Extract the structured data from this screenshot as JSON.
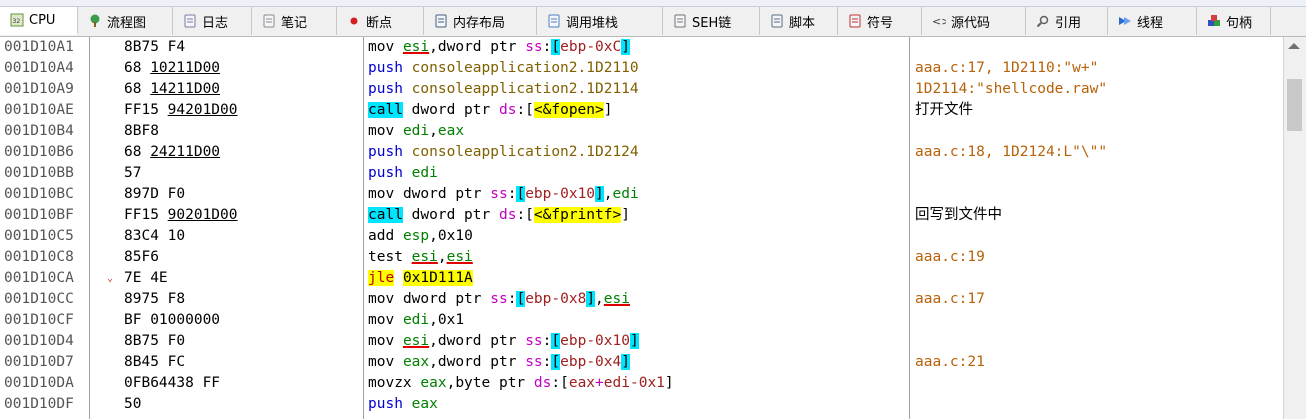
{
  "tabs": [
    {
      "label": "CPU",
      "icon": "cpu-icon",
      "active": true,
      "width": 78
    },
    {
      "label": "流程图",
      "icon": "flowchart-icon",
      "width": 95
    },
    {
      "label": "日志",
      "icon": "log-icon",
      "width": 79
    },
    {
      "label": "笔记",
      "icon": "notes-icon",
      "width": 85
    },
    {
      "label": "断点",
      "icon": "breakpoint-icon",
      "width": 87
    },
    {
      "label": "内存布局",
      "icon": "memory-map-icon",
      "width": 113
    },
    {
      "label": "调用堆栈",
      "icon": "call-stack-icon",
      "width": 126
    },
    {
      "label": "SEH链",
      "icon": "seh-chain-icon",
      "width": 97
    },
    {
      "label": "脚本",
      "icon": "script-icon",
      "width": 78
    },
    {
      "label": "符号",
      "icon": "symbols-icon",
      "width": 84
    },
    {
      "label": "源代码",
      "icon": "source-icon",
      "width": 104
    },
    {
      "label": "引用",
      "icon": "references-icon",
      "width": 82
    },
    {
      "label": "线程",
      "icon": "threads-icon",
      "width": 89
    },
    {
      "label": "句柄",
      "icon": "handles-icon",
      "width": 74
    }
  ],
  "rows": [
    {
      "addr": "001D10A1",
      "bytes": "8B75 F4",
      "ins": "mov",
      "ops": "esi,dword ptr ss:[ebp-0xC]",
      "comment": ""
    },
    {
      "addr": "001D10A4",
      "bytes": "68 10211D00",
      "ins": "push",
      "ops": "consoleapplication2.1D2110",
      "comment": "aaa.c:17, 1D2110:\"w+\""
    },
    {
      "addr": "001D10A9",
      "bytes": "68 14211D00",
      "ins": "push",
      "ops": "consoleapplication2.1D2114",
      "comment": "1D2114:\"shellcode.raw\""
    },
    {
      "addr": "001D10AE",
      "bytes": "FF15 94201D00",
      "ins": "call",
      "ops": "dword ptr ds:[<&fopen>]",
      "comment": "打开文件"
    },
    {
      "addr": "001D10B4",
      "bytes": "8BF8",
      "ins": "mov",
      "ops": "edi,eax",
      "comment": ""
    },
    {
      "addr": "001D10B6",
      "bytes": "68 24211D00",
      "ins": "push",
      "ops": "consoleapplication2.1D2124",
      "comment": "aaa.c:18, 1D2124:L\"\\\"\""
    },
    {
      "addr": "001D10BB",
      "bytes": "57",
      "ins": "push",
      "ops": "edi",
      "comment": ""
    },
    {
      "addr": "001D10BC",
      "bytes": "897D F0",
      "ins": "mov",
      "ops": "dword ptr ss:[ebp-0x10],edi",
      "comment": ""
    },
    {
      "addr": "001D10BF",
      "bytes": "FF15 90201D00",
      "ins": "call",
      "ops": "dword ptr ds:[<&fprintf>]",
      "comment": "回写到文件中"
    },
    {
      "addr": "001D10C5",
      "bytes": "83C4 10",
      "ins": "add",
      "ops": "esp,0x10",
      "comment": ""
    },
    {
      "addr": "001D10C8",
      "bytes": "85F6",
      "ins": "test",
      "ops": "esi,esi",
      "comment": "aaa.c:19"
    },
    {
      "addr": "001D10CA",
      "bytes": "7E 4E",
      "ins": "jle",
      "ops": "0x1D111A",
      "comment": ""
    },
    {
      "addr": "001D10CC",
      "bytes": "8975 F8",
      "ins": "mov",
      "ops": "dword ptr ss:[ebp-0x8],esi",
      "comment": "aaa.c:17"
    },
    {
      "addr": "001D10CF",
      "bytes": "BF 01000000",
      "ins": "mov",
      "ops": "edi,0x1",
      "comment": ""
    },
    {
      "addr": "001D10D4",
      "bytes": "8B75 F0",
      "ins": "mov",
      "ops": "esi,dword ptr ss:[ebp-0x10]",
      "comment": ""
    },
    {
      "addr": "001D10D7",
      "bytes": "8B45 FC",
      "ins": "mov",
      "ops": "eax,dword ptr ss:[ebp-0x4]",
      "comment": "aaa.c:21"
    },
    {
      "addr": "001D10DA",
      "bytes": "0FB64438 FF",
      "ins": "movzx",
      "ops": "eax,byte ptr ds:[eax+edi-0x1]",
      "comment": ""
    },
    {
      "addr": "001D10DF",
      "bytes": "50",
      "ins": "push",
      "ops": "eax",
      "comment": ""
    }
  ]
}
